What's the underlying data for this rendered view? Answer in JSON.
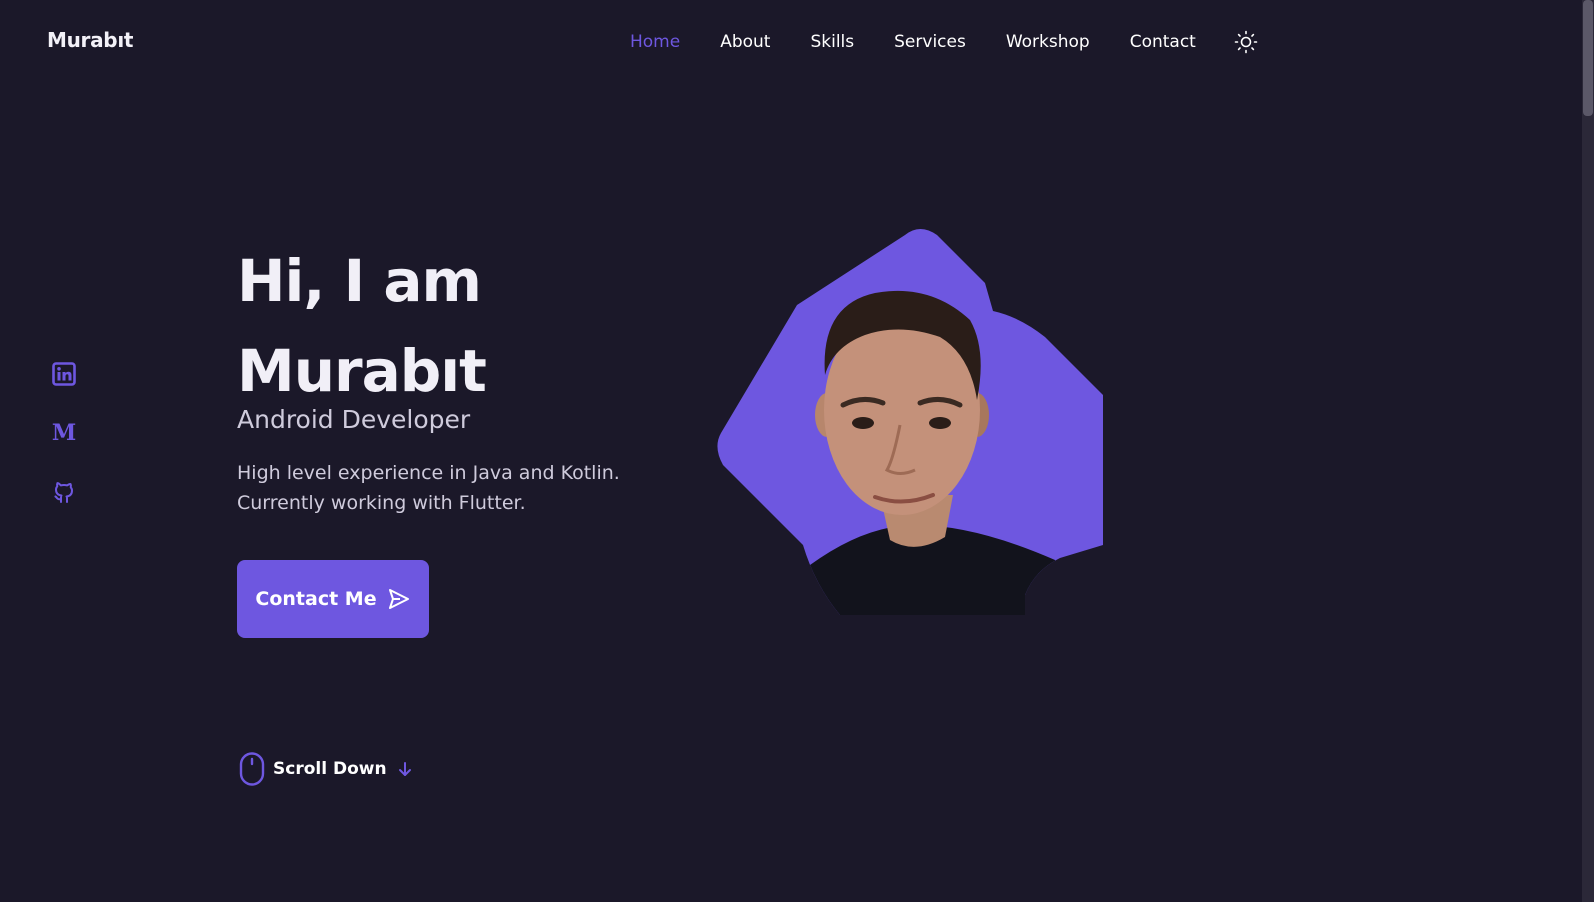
{
  "header": {
    "logo": "Murabıt",
    "nav": [
      {
        "label": "Home",
        "active": true
      },
      {
        "label": "About",
        "active": false
      },
      {
        "label": "Skills",
        "active": false
      },
      {
        "label": "Services",
        "active": false
      },
      {
        "label": "Workshop",
        "active": false
      },
      {
        "label": "Contact",
        "active": false
      }
    ],
    "theme_icon": "sun-icon"
  },
  "social": [
    {
      "icon": "linkedin-icon"
    },
    {
      "icon": "medium-icon",
      "glyph": "M"
    },
    {
      "icon": "github-icon"
    }
  ],
  "hero": {
    "title_line1": "Hi, I am",
    "title_line2": "Murabıt",
    "subtitle": "Android Developer",
    "description_line1": "High level experience in Java and Kotlin.",
    "description_line2": "Currently working with Flutter.",
    "contact_button": "Contact Me",
    "contact_icon": "send-icon",
    "scroll_down": "Scroll Down",
    "scroll_icon": "mouse-icon",
    "arrow_icon": "arrow-down-icon"
  },
  "colors": {
    "background": "#1b1829",
    "accent": "#6e57e0",
    "text": "#ffffff",
    "muted_text": "#cfcbdc"
  }
}
